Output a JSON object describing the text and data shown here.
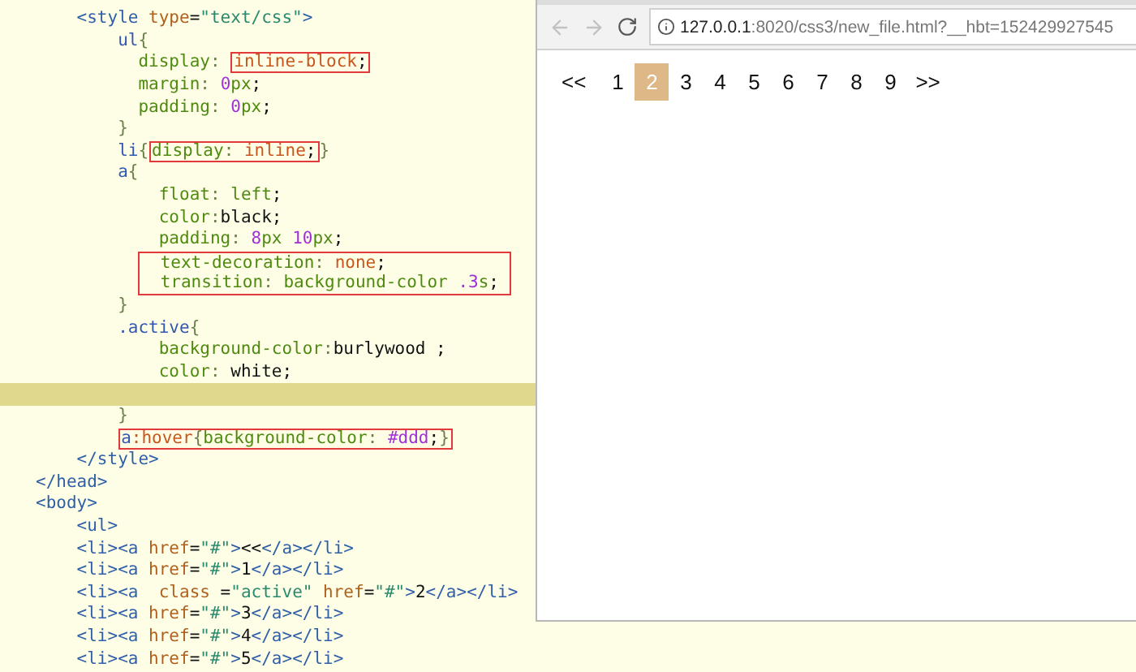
{
  "editor": {
    "lines": [
      {
        "current": false,
        "segments": [
          {
            "kind": "tag",
            "t": "    <style"
          },
          {
            "kind": "attr",
            "t": " type"
          },
          {
            "kind": "plain",
            "t": "="
          },
          {
            "kind": "str",
            "t": "\"text/css\""
          },
          {
            "kind": "tag",
            "t": ">"
          }
        ]
      },
      {
        "current": false,
        "segments": [
          {
            "kind": "sel",
            "t": "        ul"
          },
          {
            "kind": "punct",
            "t": "{"
          }
        ]
      },
      {
        "current": false,
        "segments": [
          {
            "kind": "prop",
            "t": "          display"
          },
          {
            "kind": "punct",
            "t": ": "
          },
          {
            "box": [
              {
                "kind": "val",
                "t": "inline-block"
              },
              {
                "kind": "plain",
                "t": ";"
              }
            ]
          }
        ]
      },
      {
        "current": false,
        "segments": [
          {
            "kind": "prop",
            "t": "          margin"
          },
          {
            "kind": "punct",
            "t": ": "
          },
          {
            "kind": "num",
            "t": "0"
          },
          {
            "kind": "prop",
            "t": "px"
          },
          {
            "kind": "plain",
            "t": ";"
          }
        ]
      },
      {
        "current": false,
        "segments": [
          {
            "kind": "prop",
            "t": "          padding"
          },
          {
            "kind": "punct",
            "t": ": "
          },
          {
            "kind": "num",
            "t": "0"
          },
          {
            "kind": "prop",
            "t": "px"
          },
          {
            "kind": "plain",
            "t": ";"
          }
        ]
      },
      {
        "current": false,
        "segments": [
          {
            "kind": "punct",
            "t": "        }"
          }
        ]
      },
      {
        "current": false,
        "segments": [
          {
            "kind": "sel",
            "t": "        li"
          },
          {
            "kind": "punct",
            "t": "{"
          },
          {
            "box": [
              {
                "kind": "prop",
                "t": "display"
              },
              {
                "kind": "punct",
                "t": ": "
              },
              {
                "kind": "val",
                "t": "inline"
              },
              {
                "kind": "plain",
                "t": ";"
              }
            ]
          },
          {
            "kind": "punct",
            "t": "}"
          }
        ]
      },
      {
        "current": false,
        "segments": [
          {
            "kind": "sel",
            "t": "        a"
          },
          {
            "kind": "punct",
            "t": "{"
          }
        ]
      },
      {
        "current": false,
        "segments": [
          {
            "kind": "prop",
            "t": "            float"
          },
          {
            "kind": "punct",
            "t": ": "
          },
          {
            "kind": "prop",
            "t": "left"
          },
          {
            "kind": "plain",
            "t": ";"
          }
        ]
      },
      {
        "current": false,
        "segments": [
          {
            "kind": "prop",
            "t": "            color"
          },
          {
            "kind": "punct",
            "t": ":"
          },
          {
            "kind": "plain",
            "t": "black;"
          }
        ]
      },
      {
        "current": false,
        "segments": [
          {
            "kind": "prop",
            "t": "            padding"
          },
          {
            "kind": "punct",
            "t": ": "
          },
          {
            "kind": "num",
            "t": "8"
          },
          {
            "kind": "prop",
            "t": "px "
          },
          {
            "kind": "num",
            "t": "10"
          },
          {
            "kind": "prop",
            "t": "px"
          },
          {
            "kind": "plain",
            "t": ";"
          }
        ]
      },
      {
        "current": false,
        "box_lines": [
          [
            {
              "kind": "prop",
              "t": "  text-decoration"
            },
            {
              "kind": "punct",
              "t": ": "
            },
            {
              "kind": "val",
              "t": "none"
            },
            {
              "kind": "plain",
              "t": ";"
            }
          ],
          [
            {
              "kind": "prop",
              "t": "  transition"
            },
            {
              "kind": "punct",
              "t": ": "
            },
            {
              "kind": "prop",
              "t": "background-color"
            },
            {
              "kind": "num",
              "t": " .3"
            },
            {
              "kind": "prop",
              "t": "s"
            },
            {
              "kind": "plain",
              "t": ";"
            }
          ]
        ]
      },
      {
        "current": false,
        "segments": [
          {
            "kind": "punct",
            "t": "        }"
          }
        ]
      },
      {
        "current": false,
        "segments": [
          {
            "kind": "sel",
            "t": "        .active"
          },
          {
            "kind": "punct",
            "t": "{"
          }
        ]
      },
      {
        "current": false,
        "segments": [
          {
            "kind": "prop",
            "t": "            background-color"
          },
          {
            "kind": "punct",
            "t": ":"
          },
          {
            "kind": "plain",
            "t": "burlywood ;"
          }
        ]
      },
      {
        "current": false,
        "segments": [
          {
            "kind": "prop",
            "t": "            color"
          },
          {
            "kind": "punct",
            "t": ": "
          },
          {
            "kind": "plain",
            "t": "white;"
          }
        ]
      },
      {
        "current": true
      },
      {
        "current": false,
        "segments": [
          {
            "kind": "punct",
            "t": "        }"
          }
        ]
      },
      {
        "current": false,
        "segments": [
          {
            "box": [
              {
                "kind": "sel",
                "t": "a"
              },
              {
                "kind": "val",
                "t": ":hover"
              },
              {
                "kind": "punct",
                "t": "{"
              },
              {
                "kind": "prop",
                "t": "background-color"
              },
              {
                "kind": "punct",
                "t": ": "
              },
              {
                "kind": "num",
                "t": "#ddd"
              },
              {
                "kind": "plain",
                "t": ";"
              },
              {
                "kind": "punct",
                "t": "}"
              }
            ]
          }
        ]
      },
      {
        "current": false,
        "segments": [
          {
            "kind": "tag",
            "t": "    </style>"
          }
        ]
      },
      {
        "current": false,
        "segments": [
          {
            "kind": "tag",
            "t": "</head>"
          }
        ]
      },
      {
        "current": false,
        "segments": [
          {
            "kind": "tag",
            "t": "<body>"
          }
        ]
      },
      {
        "current": false,
        "segments": [
          {
            "kind": "tag",
            "t": "    <ul>"
          }
        ]
      },
      {
        "current": false,
        "segments": [
          {
            "kind": "tag",
            "t": "    <li><a"
          },
          {
            "kind": "attr",
            "t": " href"
          },
          {
            "kind": "plain",
            "t": "="
          },
          {
            "kind": "str",
            "t": "\"#\""
          },
          {
            "kind": "tag",
            "t": ">"
          },
          {
            "kind": "plain",
            "t": "<<"
          },
          {
            "kind": "tag",
            "t": "</a></li>"
          }
        ]
      },
      {
        "current": false,
        "segments": [
          {
            "kind": "tag",
            "t": "    <li><a"
          },
          {
            "kind": "attr",
            "t": " href"
          },
          {
            "kind": "plain",
            "t": "="
          },
          {
            "kind": "str",
            "t": "\"#\""
          },
          {
            "kind": "tag",
            "t": ">"
          },
          {
            "kind": "plain",
            "t": "1"
          },
          {
            "kind": "tag",
            "t": "</a></li>"
          }
        ]
      },
      {
        "current": false,
        "segments": [
          {
            "kind": "tag",
            "t": "    <li><a"
          },
          {
            "kind": "attr",
            "t": "  class"
          },
          {
            "kind": "plain",
            "t": " ="
          },
          {
            "kind": "str",
            "t": "\"active\""
          },
          {
            "kind": "attr",
            "t": " href"
          },
          {
            "kind": "plain",
            "t": "="
          },
          {
            "kind": "str",
            "t": "\"#\""
          },
          {
            "kind": "tag",
            "t": ">"
          },
          {
            "kind": "plain",
            "t": "2"
          },
          {
            "kind": "tag",
            "t": "</a></li>"
          }
        ]
      },
      {
        "current": false,
        "segments": [
          {
            "kind": "tag",
            "t": "    <li><a"
          },
          {
            "kind": "attr",
            "t": " href"
          },
          {
            "kind": "plain",
            "t": "="
          },
          {
            "kind": "str",
            "t": "\"#\""
          },
          {
            "kind": "tag",
            "t": ">"
          },
          {
            "kind": "plain",
            "t": "3"
          },
          {
            "kind": "tag",
            "t": "</a></li>"
          }
        ]
      },
      {
        "current": false,
        "segments": [
          {
            "kind": "tag",
            "t": "    <li><a"
          },
          {
            "kind": "attr",
            "t": " href"
          },
          {
            "kind": "plain",
            "t": "="
          },
          {
            "kind": "str",
            "t": "\"#\""
          },
          {
            "kind": "tag",
            "t": ">"
          },
          {
            "kind": "plain",
            "t": "4"
          },
          {
            "kind": "tag",
            "t": "</a></li>"
          }
        ]
      },
      {
        "current": false,
        "segments": [
          {
            "kind": "tag",
            "t": "    <li><a"
          },
          {
            "kind": "attr",
            "t": " href"
          },
          {
            "kind": "plain",
            "t": "="
          },
          {
            "kind": "str",
            "t": "\"#\""
          },
          {
            "kind": "tag",
            "t": ">"
          },
          {
            "kind": "plain",
            "t": "5"
          },
          {
            "kind": "tag",
            "t": "</a></li>"
          }
        ]
      }
    ]
  },
  "browser": {
    "url_host": "127.0.0.1",
    "url_rest": ":8020/css3/new_file.html?__hbt=152429927545",
    "pagination": [
      {
        "label": "<<",
        "selected": false
      },
      {
        "label": "1",
        "selected": false
      },
      {
        "label": "2",
        "selected": true
      },
      {
        "label": "3",
        "selected": false
      },
      {
        "label": "4",
        "selected": false
      },
      {
        "label": "5",
        "selected": false
      },
      {
        "label": "6",
        "selected": false
      },
      {
        "label": "7",
        "selected": false
      },
      {
        "label": "8",
        "selected": false
      },
      {
        "label": "9",
        "selected": false
      },
      {
        "label": ">>",
        "selected": false
      }
    ]
  }
}
